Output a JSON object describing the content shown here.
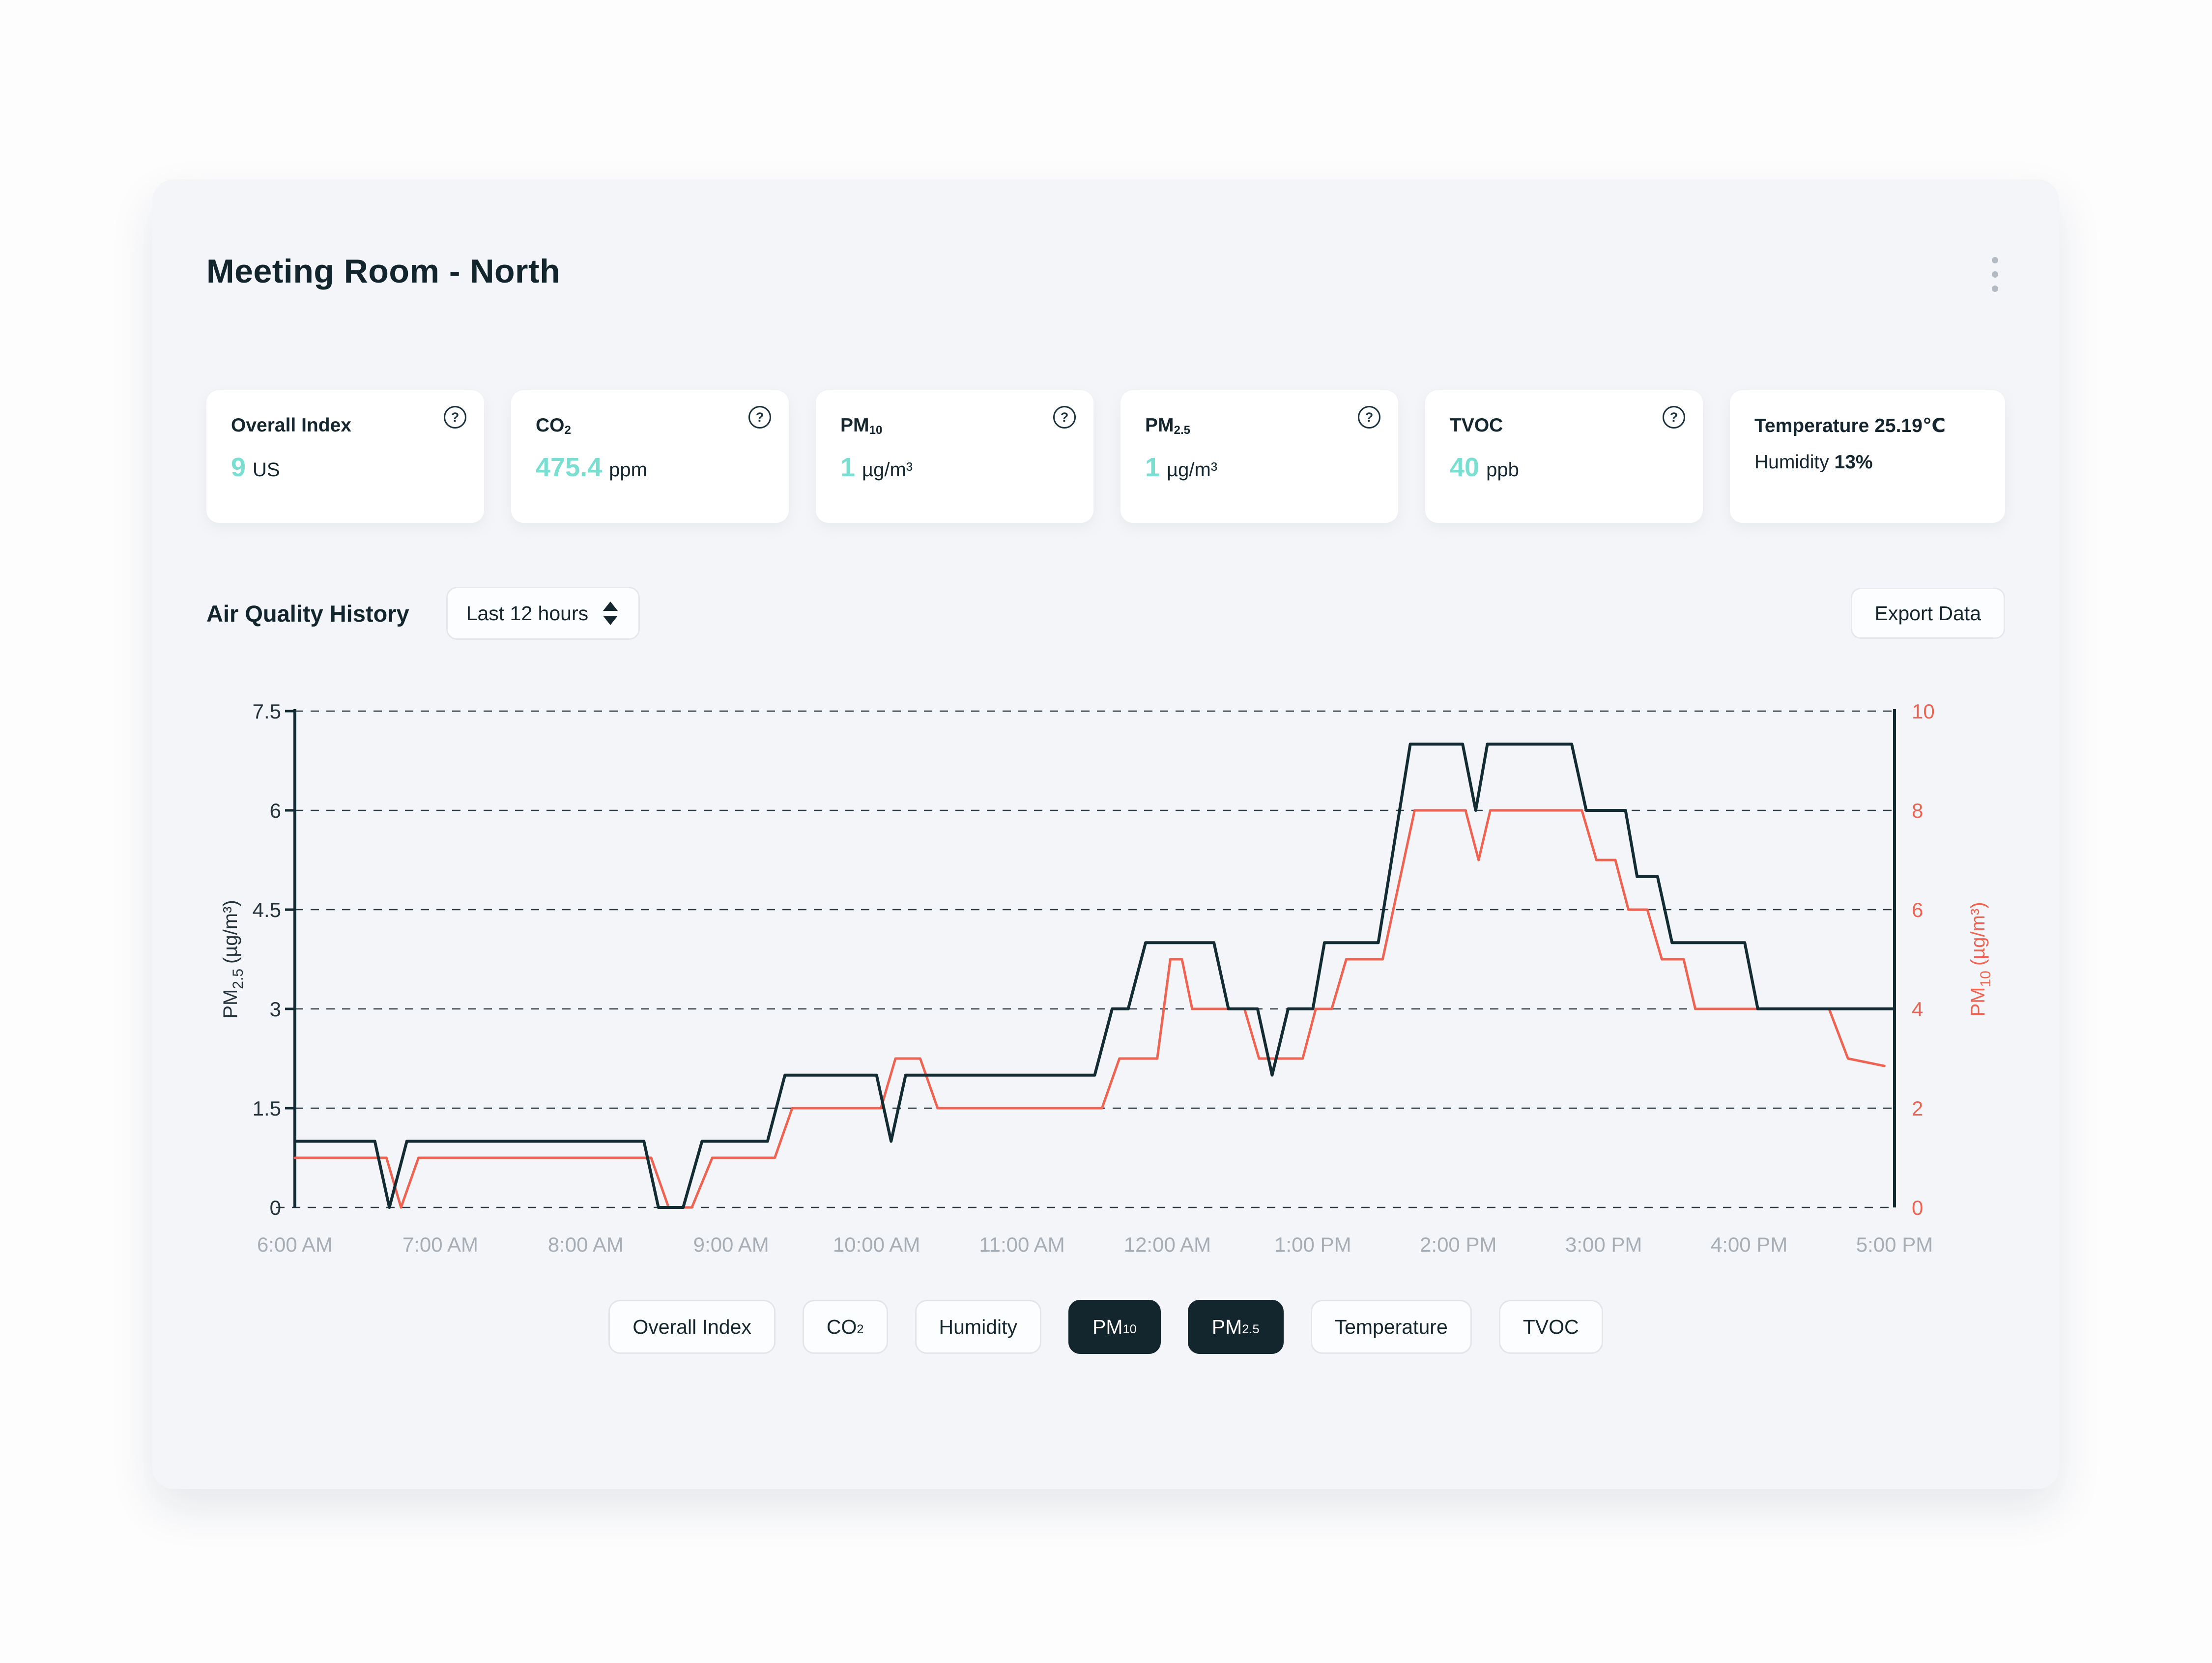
{
  "header": {
    "title": "Meeting Room - North"
  },
  "ui": {
    "help_glyph": "?"
  },
  "metric_cards": [
    {
      "label": "Overall Index",
      "label_sub": "",
      "value": "9",
      "unit": "US",
      "has_help": true
    },
    {
      "label": "CO",
      "label_sub": "2",
      "value": "475.4",
      "unit": "ppm",
      "has_help": true
    },
    {
      "label": "PM",
      "label_sub": "10",
      "value": "1",
      "unit": "µg/m³",
      "has_help": true
    },
    {
      "label": "PM",
      "label_sub": "2.5",
      "value": "1",
      "unit": "µg/m³",
      "has_help": true
    },
    {
      "label": "TVOC",
      "label_sub": "",
      "value": "40",
      "unit": "ppb",
      "has_help": true
    }
  ],
  "environment_card": {
    "temperature_label": "Temperature",
    "temperature_value": "25.19℃",
    "humidity_label": "Humidity",
    "humidity_value": "13%"
  },
  "history_section": {
    "title": "Air Quality History",
    "time_range_value": "Last 12 hours",
    "export_button": "Export Data"
  },
  "legend_chips": [
    {
      "label": "Overall Index",
      "sub": "",
      "active": false
    },
    {
      "label": "CO",
      "sub": "2",
      "active": false
    },
    {
      "label": "Humidity",
      "sub": "",
      "active": false
    },
    {
      "label": "PM",
      "sub": "10",
      "active": true
    },
    {
      "label": "PM",
      "sub": "2.5",
      "active": true
    },
    {
      "label": "Temperature",
      "sub": "",
      "active": false
    },
    {
      "label": "TVOC",
      "sub": "",
      "active": false
    }
  ],
  "colors": {
    "accent_teal": "#7adfd1",
    "line_dark": "#132b33",
    "line_red": "#ee6352",
    "tick_gray": "#a7adb5",
    "text_dark": "#15262e",
    "card_bg": "#f3f5f8"
  },
  "chart_data": {
    "type": "line",
    "title": "Air Quality History",
    "time_window": "Last 12 hours",
    "grid": "horizontal-dashed",
    "legend_position": "none",
    "x_unit": "hour_of_day",
    "x_range_hours": [
      6,
      17
    ],
    "x_tick_hours": [
      6,
      7,
      8,
      9,
      10,
      11,
      12,
      13,
      14,
      15,
      16,
      17
    ],
    "x_tick_labels": [
      "6:00 AM",
      "7:00 AM",
      "8:00 AM",
      "9:00 AM",
      "10:00 AM",
      "11:00 AM",
      "12:00 AM",
      "1:00 PM",
      "2:00 PM",
      "3:00 PM",
      "4:00 PM",
      "5:00 PM"
    ],
    "left_axis": {
      "label_main": "PM",
      "label_sub": "2.5",
      "label_unit": "(µg/m³)",
      "range": [
        0,
        7.5
      ],
      "ticks": [
        0,
        1.5,
        3,
        4.5,
        6,
        7.5
      ],
      "tick_labels": [
        "0",
        "1.5",
        "3",
        "4.5",
        "6",
        "7.5"
      ],
      "color": "#24333b"
    },
    "right_axis": {
      "label_main": "PM",
      "label_sub": "10",
      "label_unit": "(µg/m³)",
      "range": [
        0,
        10
      ],
      "ticks": [
        0,
        2,
        4,
        6,
        8,
        10
      ],
      "tick_labels": [
        "0",
        "2",
        "4",
        "6",
        "8",
        "10"
      ],
      "color": "#ee6352"
    },
    "series": [
      {
        "name": "PM10",
        "axis": "right",
        "color": "#ee6352",
        "stroke_width": 5,
        "points": [
          [
            6.0,
            1
          ],
          [
            6.63,
            1
          ],
          [
            6.73,
            0
          ],
          [
            6.85,
            1
          ],
          [
            8.45,
            1
          ],
          [
            8.57,
            0
          ],
          [
            8.73,
            0
          ],
          [
            8.87,
            1
          ],
          [
            9.3,
            1
          ],
          [
            9.42,
            2
          ],
          [
            10.03,
            2
          ],
          [
            10.13,
            3
          ],
          [
            10.3,
            3
          ],
          [
            10.42,
            2
          ],
          [
            11.55,
            2
          ],
          [
            11.67,
            3
          ],
          [
            11.93,
            3
          ],
          [
            12.02,
            5
          ],
          [
            12.1,
            5
          ],
          [
            12.17,
            4
          ],
          [
            12.53,
            4
          ],
          [
            12.63,
            3
          ],
          [
            12.93,
            3
          ],
          [
            13.02,
            4
          ],
          [
            13.13,
            4
          ],
          [
            13.23,
            5
          ],
          [
            13.48,
            5
          ],
          [
            13.7,
            8
          ],
          [
            14.05,
            8
          ],
          [
            14.14,
            7
          ],
          [
            14.22,
            8
          ],
          [
            14.85,
            8
          ],
          [
            14.95,
            7
          ],
          [
            15.08,
            7
          ],
          [
            15.17,
            6
          ],
          [
            15.3,
            6
          ],
          [
            15.4,
            5
          ],
          [
            15.55,
            5
          ],
          [
            15.63,
            4
          ],
          [
            16.55,
            4
          ],
          [
            16.68,
            3
          ],
          [
            16.93,
            2.85
          ]
        ]
      },
      {
        "name": "PM2.5",
        "axis": "left",
        "color": "#132b33",
        "stroke_width": 6,
        "points": [
          [
            6.0,
            1
          ],
          [
            6.55,
            1
          ],
          [
            6.65,
            0
          ],
          [
            6.77,
            1
          ],
          [
            8.4,
            1
          ],
          [
            8.5,
            0
          ],
          [
            8.67,
            0
          ],
          [
            8.8,
            1
          ],
          [
            9.25,
            1
          ],
          [
            9.37,
            2
          ],
          [
            10.0,
            2
          ],
          [
            10.1,
            1
          ],
          [
            10.2,
            2
          ],
          [
            11.5,
            2
          ],
          [
            11.62,
            3
          ],
          [
            11.73,
            3
          ],
          [
            11.85,
            4
          ],
          [
            12.32,
            4
          ],
          [
            12.42,
            3
          ],
          [
            12.62,
            3
          ],
          [
            12.72,
            2
          ],
          [
            12.83,
            3
          ],
          [
            13.0,
            3
          ],
          [
            13.08,
            4
          ],
          [
            13.45,
            4
          ],
          [
            13.67,
            7
          ],
          [
            14.03,
            7
          ],
          [
            14.12,
            6
          ],
          [
            14.2,
            7
          ],
          [
            14.78,
            7
          ],
          [
            14.88,
            6
          ],
          [
            15.15,
            6
          ],
          [
            15.23,
            5
          ],
          [
            15.37,
            5
          ],
          [
            15.47,
            4
          ],
          [
            15.97,
            4
          ],
          [
            16.06,
            3
          ],
          [
            17.0,
            3
          ]
        ]
      }
    ]
  }
}
